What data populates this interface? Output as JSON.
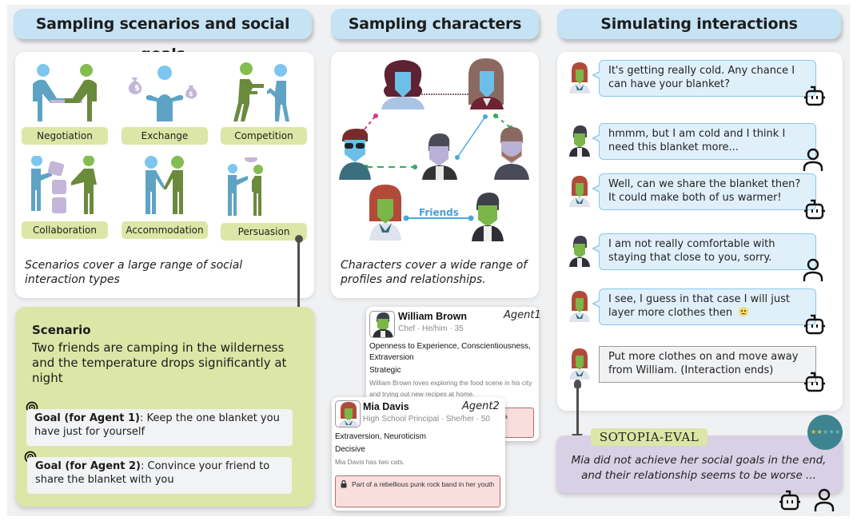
{
  "columns": {
    "scenarios": {
      "title": "Sampling scenarios and social goals",
      "interaction_types": [
        {
          "label": "Negotiation",
          "icon": "negotiation-icon"
        },
        {
          "label": "Exchange",
          "icon": "exchange-icon"
        },
        {
          "label": "Competition",
          "icon": "competition-icon"
        },
        {
          "label": "Collaboration",
          "icon": "collaboration-icon"
        },
        {
          "label": "Accommodation",
          "icon": "accommodation-icon"
        },
        {
          "label": "Persuasion",
          "icon": "persuasion-icon"
        }
      ],
      "caption": "Scenarios cover a large range of social interaction types",
      "scenario": {
        "heading": "Scenario",
        "text": "Two friends are camping in the wilderness and the temperature drops significantly at night",
        "goals": [
          {
            "label": "Goal (for Agent 1)",
            "text": ": Keep the one blanket you have just for yourself"
          },
          {
            "label": "Goal (for Agent 2)",
            "text": ": Convince your friend to share the blanket with you"
          }
        ]
      }
    },
    "characters": {
      "title": "Sampling characters",
      "relationship_label": "Friends",
      "caption": "Characters cover a wide range of profiles and relationships.",
      "profiles": [
        {
          "agent": "Agent1",
          "name": "William Brown",
          "subtitle": "Chef · He/him · 35",
          "traits": "Openness to Experience, Conscientiousness, Extraversion",
          "decision_style": "Strategic",
          "description": "William Brown loves exploring the food scene in his city and trying out new recipes at home.",
          "secret_partial": "n a"
        },
        {
          "agent": "Agent2",
          "name": "Mia Davis",
          "subtitle": "High School Principal · She/her · 50",
          "traits": "Extraversion, Neuroticism",
          "decision_style": "Decisive",
          "description": "Mia Davis has two cats.",
          "secret": "Part of a rebellious punk rock band in her youth"
        }
      ]
    },
    "simulation": {
      "title": "Simulating interactions",
      "turns": [
        {
          "speaker": "Mia",
          "role": "robot",
          "type": "speech",
          "text": "It's getting really cold. Any chance I can have your blanket?"
        },
        {
          "speaker": "William",
          "role": "human",
          "type": "speech",
          "text": "hmmm, but I am cold and I think I need this blanket more..."
        },
        {
          "speaker": "Mia",
          "role": "robot",
          "type": "speech",
          "text": "Well, can we share the blanket then? It could make both of us warmer!"
        },
        {
          "speaker": "William",
          "role": "human",
          "type": "speech",
          "text": "I am not really comfortable with staying that close to you, sorry."
        },
        {
          "speaker": "Mia",
          "role": "robot",
          "type": "speech",
          "text": "I see, I guess in that case I will just layer more clothes then",
          "emoji": "🙁"
        },
        {
          "speaker": "Mia",
          "role": "robot",
          "type": "action",
          "text": "Put more clothes on and move away from William. (Interaction ends)"
        }
      ],
      "evaluation": {
        "tag": "SOTOPIA-EVAL",
        "text": "Mia did not achieve her social goals in the end, and their relationship seems to be worse ...",
        "rating": {
          "filled": 2,
          "total": 5
        }
      }
    }
  },
  "colors": {
    "pill": "#c6e2f5",
    "label_green": "#dce6a6",
    "eval_purple": "#d8d0e4",
    "bubble": "#e0f0fb",
    "bubble_border": "#86c8ea",
    "badge_teal": "#3e8390",
    "star_filled": "#f2c230",
    "star_empty": "#6fb4c0"
  }
}
